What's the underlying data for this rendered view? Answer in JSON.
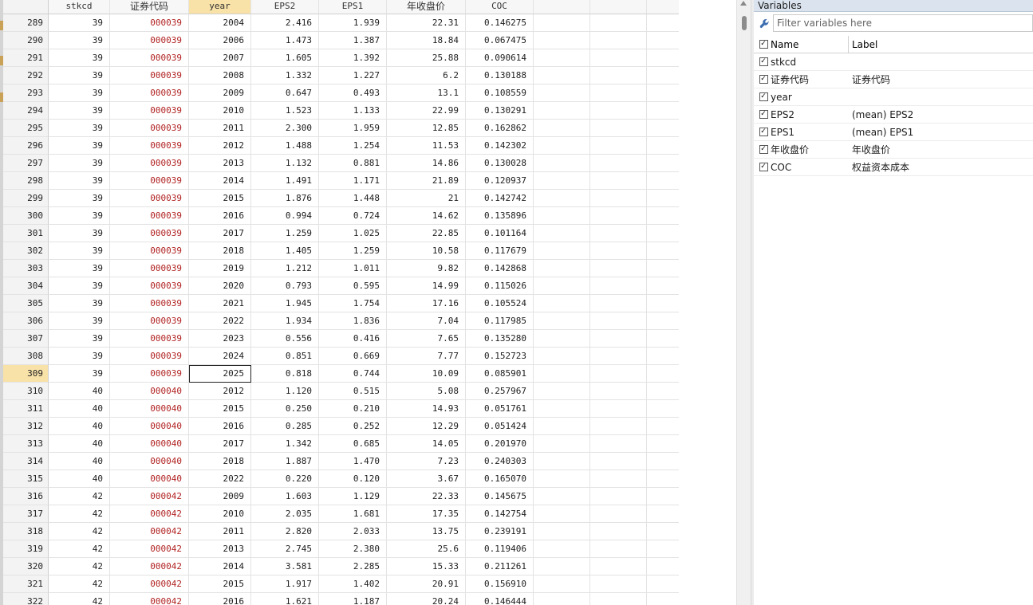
{
  "grid": {
    "columns": [
      "stkcd",
      "证券代码",
      "year",
      "EPS2",
      "EPS1",
      "年收盘价",
      "COC"
    ],
    "selected_column": "year",
    "current_row": "309",
    "rows": [
      [
        "289",
        "39",
        "000039",
        "2004",
        "2.416",
        "1.939",
        "22.31",
        "0.146275"
      ],
      [
        "290",
        "39",
        "000039",
        "2006",
        "1.473",
        "1.387",
        "18.84",
        "0.067475"
      ],
      [
        "291",
        "39",
        "000039",
        "2007",
        "1.605",
        "1.392",
        "25.88",
        "0.090614"
      ],
      [
        "292",
        "39",
        "000039",
        "2008",
        "1.332",
        "1.227",
        "6.2",
        "0.130188"
      ],
      [
        "293",
        "39",
        "000039",
        "2009",
        "0.647",
        "0.493",
        "13.1",
        "0.108559"
      ],
      [
        "294",
        "39",
        "000039",
        "2010",
        "1.523",
        "1.133",
        "22.99",
        "0.130291"
      ],
      [
        "295",
        "39",
        "000039",
        "2011",
        "2.300",
        "1.959",
        "12.85",
        "0.162862"
      ],
      [
        "296",
        "39",
        "000039",
        "2012",
        "1.488",
        "1.254",
        "11.53",
        "0.142302"
      ],
      [
        "297",
        "39",
        "000039",
        "2013",
        "1.132",
        "0.881",
        "14.86",
        "0.130028"
      ],
      [
        "298",
        "39",
        "000039",
        "2014",
        "1.491",
        "1.171",
        "21.89",
        "0.120937"
      ],
      [
        "299",
        "39",
        "000039",
        "2015",
        "1.876",
        "1.448",
        "21",
        "0.142742"
      ],
      [
        "300",
        "39",
        "000039",
        "2016",
        "0.994",
        "0.724",
        "14.62",
        "0.135896"
      ],
      [
        "301",
        "39",
        "000039",
        "2017",
        "1.259",
        "1.025",
        "22.85",
        "0.101164"
      ],
      [
        "302",
        "39",
        "000039",
        "2018",
        "1.405",
        "1.259",
        "10.58",
        "0.117679"
      ],
      [
        "303",
        "39",
        "000039",
        "2019",
        "1.212",
        "1.011",
        "9.82",
        "0.142868"
      ],
      [
        "304",
        "39",
        "000039",
        "2020",
        "0.793",
        "0.595",
        "14.99",
        "0.115026"
      ],
      [
        "305",
        "39",
        "000039",
        "2021",
        "1.945",
        "1.754",
        "17.16",
        "0.105524"
      ],
      [
        "306",
        "39",
        "000039",
        "2022",
        "1.934",
        "1.836",
        "7.04",
        "0.117985"
      ],
      [
        "307",
        "39",
        "000039",
        "2023",
        "0.556",
        "0.416",
        "7.65",
        "0.135280"
      ],
      [
        "308",
        "39",
        "000039",
        "2024",
        "0.851",
        "0.669",
        "7.77",
        "0.152723"
      ],
      [
        "309",
        "39",
        "000039",
        "2025",
        "0.818",
        "0.744",
        "10.09",
        "0.085901"
      ],
      [
        "310",
        "40",
        "000040",
        "2012",
        "1.120",
        "0.515",
        "5.08",
        "0.257967"
      ],
      [
        "311",
        "40",
        "000040",
        "2015",
        "0.250",
        "0.210",
        "14.93",
        "0.051761"
      ],
      [
        "312",
        "40",
        "000040",
        "2016",
        "0.285",
        "0.252",
        "12.29",
        "0.051424"
      ],
      [
        "313",
        "40",
        "000040",
        "2017",
        "1.342",
        "0.685",
        "14.05",
        "0.201970"
      ],
      [
        "314",
        "40",
        "000040",
        "2018",
        "1.887",
        "1.470",
        "7.23",
        "0.240303"
      ],
      [
        "315",
        "40",
        "000040",
        "2022",
        "0.220",
        "0.120",
        "3.67",
        "0.165070"
      ],
      [
        "316",
        "42",
        "000042",
        "2009",
        "1.603",
        "1.129",
        "22.33",
        "0.145675"
      ],
      [
        "317",
        "42",
        "000042",
        "2010",
        "2.035",
        "1.681",
        "17.35",
        "0.142754"
      ],
      [
        "318",
        "42",
        "000042",
        "2011",
        "2.820",
        "2.033",
        "13.75",
        "0.239191"
      ],
      [
        "319",
        "42",
        "000042",
        "2013",
        "2.745",
        "2.380",
        "25.6",
        "0.119406"
      ],
      [
        "320",
        "42",
        "000042",
        "2014",
        "3.581",
        "2.285",
        "15.33",
        "0.211261"
      ],
      [
        "321",
        "42",
        "000042",
        "2015",
        "1.917",
        "1.402",
        "20.91",
        "0.156910"
      ],
      [
        "322",
        "42",
        "000042",
        "2016",
        "1.621",
        "1.187",
        "20.24",
        "0.146444"
      ]
    ]
  },
  "variables": {
    "title": "Variables",
    "filter_placeholder": "Filter variables here",
    "header_name": "Name",
    "header_label": "Label",
    "items": [
      {
        "name": "stkcd",
        "label": ""
      },
      {
        "name": "证券代码",
        "label": "证券代码"
      },
      {
        "name": "year",
        "label": ""
      },
      {
        "name": "EPS2",
        "label": "(mean) EPS2"
      },
      {
        "name": "EPS1",
        "label": "(mean) EPS1"
      },
      {
        "name": "年收盘价",
        "label": "年收盘价"
      },
      {
        "name": "COC",
        "label": "权益资本成本"
      }
    ]
  },
  "icons": {
    "filter": "wrench-icon",
    "checkbox": "checkbox-checked-icon",
    "scroll_up": "scroll-up-arrow-icon"
  },
  "colors": {
    "code_text": "#b22222",
    "selection_highlight": "#f8e2a8",
    "panel_title_bg": "#dbe4ee"
  }
}
